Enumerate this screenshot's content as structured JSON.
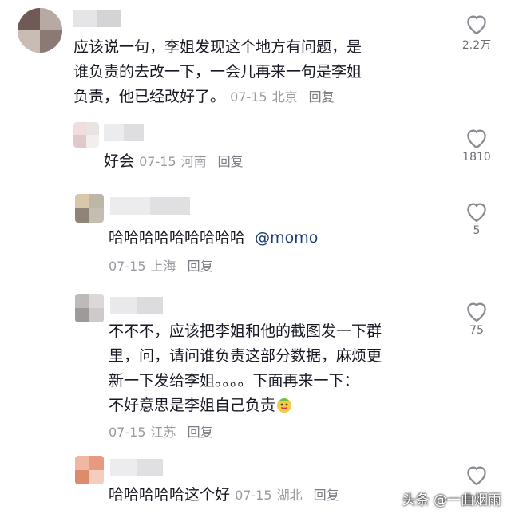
{
  "comments": [
    {
      "text_lines": [
        "应该说一句，李姐发现这个地方有问题，是",
        "谁负责的去改一下，一会儿再来一句是李姐"
      ],
      "last_line": "负责，他已经改好了。",
      "date": "07-15",
      "location": "北京",
      "reply_label": "回复",
      "likes": "2.2万"
    },
    {
      "text": "好会",
      "date": "07-15",
      "location": "河南",
      "reply_label": "回复",
      "likes": "1810"
    },
    {
      "text": "哈哈哈哈哈哈哈哈哈",
      "mention": "@momo",
      "date": "07-15",
      "location": "上海",
      "reply_label": "回复",
      "likes": "5"
    },
    {
      "text_lines": [
        "不不不，应该把李姐和他的截图发一下群",
        "里，问，请问谁负责这部分数据，麻烦更",
        "新一下发给李姐。。。。下面再来一下："
      ],
      "last_line": "不好意思是李姐自己负责",
      "emoji": "smiling-face-emoji",
      "date": "07-15",
      "location": "江苏",
      "reply_label": "回复",
      "likes": "75"
    },
    {
      "text": "哈哈哈哈哈这个好",
      "date": "07-15",
      "location": "湖北",
      "reply_label": "回复",
      "likes": ""
    }
  ],
  "watermark": "头条 @一曲烟雨",
  "colors": {
    "text": "#161823",
    "meta": "#9a9aa3",
    "mention": "#1f3b73",
    "icon": "#8a8a92"
  }
}
